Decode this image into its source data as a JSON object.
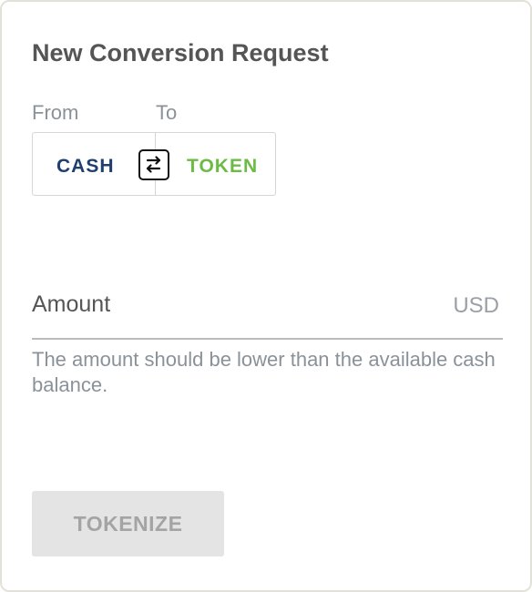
{
  "form": {
    "title": "New Conversion Request",
    "from_label": "From",
    "to_label": "To",
    "from_currency": "CASH",
    "to_currency": "TOKEN",
    "swap_icon": "swap-arrows-icon",
    "amount_label": "Amount",
    "amount_value": "",
    "currency_unit": "USD",
    "helper_text": "The amount should be lower than the available cash balance.",
    "submit_label": "TOKENIZE"
  },
  "colors": {
    "cash": "#1f3f6e",
    "token": "#6cbb45",
    "title": "#555555",
    "muted": "#8a9299",
    "button_bg": "#e4e4e4",
    "button_text": "#a4a4a4"
  }
}
